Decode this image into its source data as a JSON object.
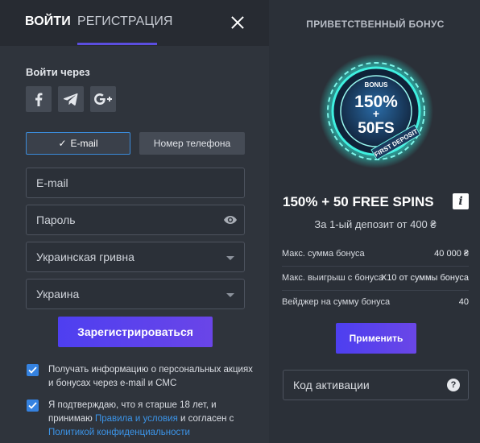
{
  "tabs": {
    "login": "ВОЙТИ",
    "register": "РЕГИСТРАЦИЯ"
  },
  "login_via": "Войти через",
  "social": [
    "facebook-icon",
    "telegram-icon",
    "google-plus-icon"
  ],
  "method": {
    "email": "E-mail",
    "phone": "Номер телефона"
  },
  "fields": {
    "email_placeholder": "E-mail",
    "password_placeholder": "Пароль",
    "currency": "Украинская гривна",
    "country": "Украина"
  },
  "register_button": "Зарегистрироваться",
  "consent": {
    "marketing": "Получать информацию о персональных акциях и бонусах через e-mail и СМС",
    "age_prefix": "Я подтверждаю, что я старше 18 лет, и принимаю ",
    "terms_link": "Правила и условия",
    "age_middle": " и согласен с ",
    "privacy_link": "Политикой конфиденциальности"
  },
  "bonus": {
    "heading": "ПРИВЕТСТВЕННЫЙ БОНУС",
    "badge": {
      "top": "BONUS",
      "main": "150%",
      "plus": "+",
      "spins": "50FS",
      "ribbon": "FIRST DEPOSIT"
    },
    "title": "150% + 50 FREE SPINS",
    "subtitle": "За 1-ый депозит от 400 ₴",
    "stats": [
      {
        "label": "Макс. сумма бонуса",
        "value": "40 000 ₴"
      },
      {
        "label": "Макс. выигрыш с бонуса",
        "value": "X10 от суммы бонуса"
      },
      {
        "label": "Вейджер на сумму бонуса",
        "value": "40"
      }
    ],
    "apply_button": "Применить",
    "activation_placeholder": "Код активации"
  },
  "colors": {
    "accent": "#5b4ee0",
    "checkbox": "#3582e0",
    "link": "#3b94e8",
    "badge_glow": "#2ee6d6"
  }
}
